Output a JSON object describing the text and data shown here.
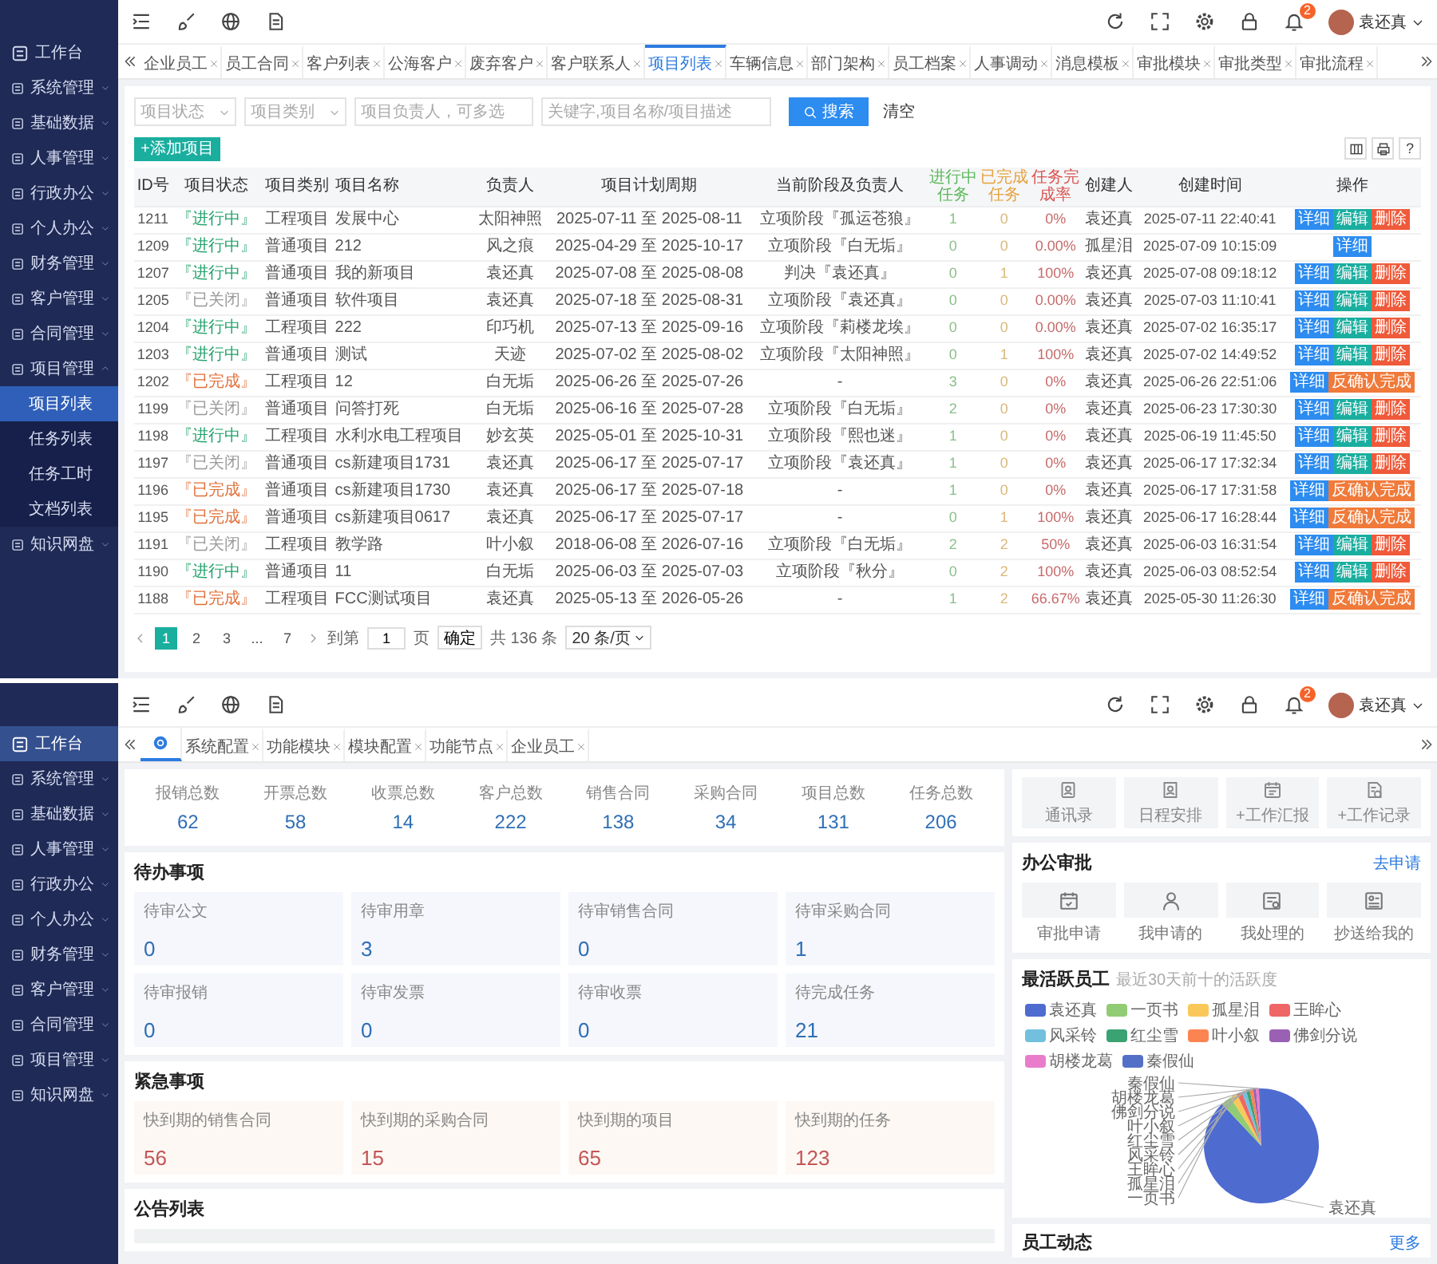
{
  "top_view": {
    "sidebar": [
      {
        "label": "工作台",
        "kind": "link",
        "selected": false
      },
      {
        "label": "系统管理",
        "kind": "group",
        "expanded": false,
        "selected": false
      },
      {
        "label": "基础数据",
        "kind": "group",
        "expanded": false,
        "selected": false
      },
      {
        "label": "人事管理",
        "kind": "group",
        "expanded": false,
        "selected": false
      },
      {
        "label": "行政办公",
        "kind": "group",
        "expanded": false,
        "selected": false
      },
      {
        "label": "个人办公",
        "kind": "group",
        "expanded": false,
        "selected": false
      },
      {
        "label": "财务管理",
        "kind": "group",
        "expanded": false,
        "selected": false
      },
      {
        "label": "客户管理",
        "kind": "group",
        "expanded": false,
        "selected": false
      },
      {
        "label": "合同管理",
        "kind": "group",
        "expanded": false,
        "selected": false
      },
      {
        "label": "项目管理",
        "kind": "group",
        "expanded": true,
        "selected": false,
        "children": [
          {
            "label": "项目列表",
            "selected": true
          },
          {
            "label": "任务列表",
            "selected": false
          },
          {
            "label": "任务工时",
            "selected": false
          },
          {
            "label": "文档列表",
            "selected": false
          }
        ]
      },
      {
        "label": "知识网盘",
        "kind": "group",
        "expanded": false,
        "selected": false
      }
    ],
    "header": {
      "notification_count": "2",
      "user_name": "袁还真"
    },
    "tabs": [
      {
        "label": "企业员工",
        "selected": false
      },
      {
        "label": "员工合同",
        "selected": false
      },
      {
        "label": "客户列表",
        "selected": false
      },
      {
        "label": "公海客户",
        "selected": false
      },
      {
        "label": "废弃客户",
        "selected": false
      },
      {
        "label": "客户联系人",
        "selected": false
      },
      {
        "label": "项目列表",
        "selected": true
      },
      {
        "label": "车辆信息",
        "selected": false
      },
      {
        "label": "部门架构",
        "selected": false
      },
      {
        "label": "员工档案",
        "selected": false
      },
      {
        "label": "人事调动",
        "selected": false
      },
      {
        "label": "消息模板",
        "selected": false
      },
      {
        "label": "审批模块",
        "selected": false
      },
      {
        "label": "审批类型",
        "selected": false
      },
      {
        "label": "审批流程",
        "selected": false
      }
    ],
    "filters": {
      "status_select": {
        "placeholder": "项目状态"
      },
      "category_select": {
        "placeholder": "项目类别"
      },
      "owner_field": {
        "placeholder": "项目负责人，可多选"
      },
      "keyword_field": {
        "placeholder": "关键字,项目名称/项目描述"
      },
      "search_button": "搜索",
      "clear_link": "清空"
    },
    "add_button": "+添加项目",
    "help_button": "?",
    "table": {
      "columns": [
        {
          "label": "ID号",
          "kind": "id"
        },
        {
          "label": "项目状态",
          "kind": "status"
        },
        {
          "label": "项目类别",
          "kind": "text"
        },
        {
          "label": "项目名称",
          "kind": "name"
        },
        {
          "label": "负责人",
          "kind": "text"
        },
        {
          "label": "项目计划周期",
          "kind": "text"
        },
        {
          "label": "当前阶段及负责人",
          "kind": "text"
        },
        {
          "label": "进行中任务",
          "kind": "green"
        },
        {
          "label": "已完成任务",
          "kind": "amber"
        },
        {
          "label": "任务完成率",
          "kind": "red"
        },
        {
          "label": "创建人",
          "kind": "text"
        },
        {
          "label": "创建时间",
          "kind": "datetime"
        },
        {
          "label": "操作",
          "kind": "actions"
        }
      ],
      "rows": [
        {
          "cells": [
            "1211",
            {
              "text": "『进行中』",
              "color": "#23a26c"
            },
            "工程项目",
            "发展中心",
            "太阳神照",
            "2025-07-11 至 2025-08-11",
            "立项阶段『孤运苍狼』",
            "1",
            "0",
            "0%",
            "袁还真",
            "2025-07-11 22:40:41"
          ],
          "actions": [
            {
              "label": "详细",
              "kind": "detail"
            },
            {
              "label": "编辑",
              "kind": "edit"
            },
            {
              "label": "删除",
              "kind": "delete"
            }
          ]
        },
        {
          "cells": [
            "1209",
            {
              "text": "『进行中』",
              "color": "#23a26c"
            },
            "普通项目",
            "212",
            "风之痕",
            "2025-04-29 至 2025-10-17",
            "立项阶段『白无垢』",
            "0",
            "0",
            "0.00%",
            "孤星泪",
            "2025-07-09 10:15:09"
          ],
          "actions": [
            {
              "label": "详细",
              "kind": "detail"
            }
          ]
        },
        {
          "cells": [
            "1207",
            {
              "text": "『进行中』",
              "color": "#23a26c"
            },
            "普通项目",
            "我的新项目",
            "袁还真",
            "2025-07-08 至 2025-08-08",
            "判决『袁还真』",
            "0",
            "1",
            "100%",
            "袁还真",
            "2025-07-08 09:18:12"
          ],
          "actions": [
            {
              "label": "详细",
              "kind": "detail"
            },
            {
              "label": "编辑",
              "kind": "edit"
            },
            {
              "label": "删除",
              "kind": "delete"
            }
          ]
        },
        {
          "cells": [
            "1205",
            {
              "text": "『已关闭』",
              "color": "#999999"
            },
            "普通项目",
            "软件项目",
            "袁还真",
            "2025-07-18 至 2025-08-31",
            "立项阶段『袁还真』",
            "0",
            "0",
            "0.00%",
            "袁还真",
            "2025-07-03 11:10:41"
          ],
          "actions": [
            {
              "label": "详细",
              "kind": "detail"
            },
            {
              "label": "编辑",
              "kind": "edit"
            },
            {
              "label": "删除",
              "kind": "delete"
            }
          ]
        },
        {
          "cells": [
            "1204",
            {
              "text": "『进行中』",
              "color": "#23a26c"
            },
            "工程项目",
            "222",
            "印巧机",
            "2025-07-13 至 2025-09-16",
            "立项阶段『莉楼龙埃』",
            "0",
            "0",
            "0.00%",
            "袁还真",
            "2025-07-02 16:35:17"
          ],
          "actions": [
            {
              "label": "详细",
              "kind": "detail"
            },
            {
              "label": "编辑",
              "kind": "edit"
            },
            {
              "label": "删除",
              "kind": "delete"
            }
          ]
        },
        {
          "cells": [
            "1203",
            {
              "text": "『进行中』",
              "color": "#23a26c"
            },
            "普通项目",
            "测试",
            "天迹",
            "2025-07-02 至 2025-08-02",
            "立项阶段『太阳神照』",
            "0",
            "1",
            "100%",
            "袁还真",
            "2025-07-02 14:49:52"
          ],
          "actions": [
            {
              "label": "详细",
              "kind": "detail"
            },
            {
              "label": "编辑",
              "kind": "edit"
            },
            {
              "label": "删除",
              "kind": "delete"
            }
          ]
        },
        {
          "cells": [
            "1202",
            {
              "text": "『已完成』",
              "color": "#e0703a"
            },
            "工程项目",
            "12",
            "白无垢",
            "2025-06-26 至 2025-07-26",
            "-",
            "3",
            "0",
            "0%",
            "袁还真",
            "2025-06-26 22:51:06"
          ],
          "actions": [
            {
              "label": "详细",
              "kind": "detail"
            },
            {
              "label": "反确认完成",
              "kind": "reconfirm"
            }
          ]
        },
        {
          "cells": [
            "1199",
            {
              "text": "『已关闭』",
              "color": "#999999"
            },
            "普通项目",
            "问答打死",
            "白无垢",
            "2025-06-16 至 2025-07-28",
            "立项阶段『白无垢』",
            "2",
            "0",
            "0%",
            "袁还真",
            "2025-06-23 17:30:30"
          ],
          "actions": [
            {
              "label": "详细",
              "kind": "detail"
            },
            {
              "label": "编辑",
              "kind": "edit"
            },
            {
              "label": "删除",
              "kind": "delete"
            }
          ]
        },
        {
          "cells": [
            "1198",
            {
              "text": "『进行中』",
              "color": "#23a26c"
            },
            "工程项目",
            "水利水电工程项目",
            "妙玄英",
            "2025-05-01 至 2025-10-31",
            "立项阶段『熙也迷』",
            "1",
            "0",
            "0%",
            "袁还真",
            "2025-06-19 11:45:50"
          ],
          "actions": [
            {
              "label": "详细",
              "kind": "detail"
            },
            {
              "label": "编辑",
              "kind": "edit"
            },
            {
              "label": "删除",
              "kind": "delete"
            }
          ]
        },
        {
          "cells": [
            "1197",
            {
              "text": "『已关闭』",
              "color": "#999999"
            },
            "普通项目",
            "cs新建项目1731",
            "袁还真",
            "2025-06-17 至 2025-07-17",
            "立项阶段『袁还真』",
            "1",
            "0",
            "0%",
            "袁还真",
            "2025-06-17 17:32:34"
          ],
          "actions": [
            {
              "label": "详细",
              "kind": "detail"
            },
            {
              "label": "编辑",
              "kind": "edit"
            },
            {
              "label": "删除",
              "kind": "delete"
            }
          ]
        },
        {
          "cells": [
            "1196",
            {
              "text": "『已完成』",
              "color": "#e0703a"
            },
            "普通项目",
            "cs新建项目1730",
            "袁还真",
            "2025-06-17 至 2025-07-18",
            "-",
            "1",
            "0",
            "0%",
            "袁还真",
            "2025-06-17 17:31:58"
          ],
          "actions": [
            {
              "label": "详细",
              "kind": "detail"
            },
            {
              "label": "反确认完成",
              "kind": "reconfirm"
            }
          ]
        },
        {
          "cells": [
            "1195",
            {
              "text": "『已完成』",
              "color": "#e0703a"
            },
            "普通项目",
            "cs新建项目0617",
            "袁还真",
            "2025-06-17 至 2025-07-17",
            "-",
            "0",
            "1",
            "100%",
            "袁还真",
            "2025-06-17 16:28:44"
          ],
          "actions": [
            {
              "label": "详细",
              "kind": "detail"
            },
            {
              "label": "反确认完成",
              "kind": "reconfirm"
            }
          ]
        },
        {
          "cells": [
            "1191",
            {
              "text": "『已关闭』",
              "color": "#999999"
            },
            "工程项目",
            "教学路",
            "叶小叙",
            "2018-06-08 至 2026-07-16",
            "立项阶段『白无垢』",
            "2",
            "2",
            "50%",
            "袁还真",
            "2025-06-03 16:31:54"
          ],
          "actions": [
            {
              "label": "详细",
              "kind": "detail"
            },
            {
              "label": "编辑",
              "kind": "edit"
            },
            {
              "label": "删除",
              "kind": "delete"
            }
          ]
        },
        {
          "cells": [
            "1190",
            {
              "text": "『进行中』",
              "color": "#23a26c"
            },
            "普通项目",
            "11",
            "白无垢",
            "2025-06-03 至 2025-07-03",
            "立项阶段『秋分』",
            "0",
            "2",
            "100%",
            "袁还真",
            "2025-06-03 08:52:54"
          ],
          "actions": [
            {
              "label": "详细",
              "kind": "detail"
            },
            {
              "label": "编辑",
              "kind": "edit"
            },
            {
              "label": "删除",
              "kind": "delete"
            }
          ]
        },
        {
          "cells": [
            "1188",
            {
              "text": "『已完成』",
              "color": "#e0703a"
            },
            "工程项目",
            "FCC测试项目",
            "袁还真",
            "2025-05-13 至 2026-05-26",
            "-",
            "1",
            "2",
            "66.67%",
            "袁还真",
            "2025-05-30 11:26:30"
          ],
          "actions": [
            {
              "label": "详细",
              "kind": "detail"
            },
            {
              "label": "反确认完成",
              "kind": "reconfirm"
            }
          ]
        }
      ]
    },
    "pagination": {
      "pages": [
        {
          "label": "1",
          "selected": true
        },
        {
          "label": "2",
          "selected": false
        },
        {
          "label": "3",
          "selected": false
        },
        {
          "label": "...",
          "selected": false
        },
        {
          "label": "7",
          "selected": false
        }
      ],
      "goto_label": "到第",
      "goto_value": "1",
      "page_unit": "页",
      "confirm": "确定",
      "total": "共 136 条",
      "page_size": "20 条/页"
    }
  },
  "bottom_view": {
    "sidebar": [
      {
        "label": "工作台",
        "kind": "link",
        "selected": true
      },
      {
        "label": "系统管理",
        "kind": "group",
        "expanded": false,
        "selected": false
      },
      {
        "label": "基础数据",
        "kind": "group",
        "expanded": false,
        "selected": false
      },
      {
        "label": "人事管理",
        "kind": "group",
        "expanded": false,
        "selected": false
      },
      {
        "label": "行政办公",
        "kind": "group",
        "expanded": false,
        "selected": false
      },
      {
        "label": "个人办公",
        "kind": "group",
        "expanded": false,
        "selected": false
      },
      {
        "label": "财务管理",
        "kind": "group",
        "expanded": false,
        "selected": false
      },
      {
        "label": "客户管理",
        "kind": "group",
        "expanded": false,
        "selected": false
      },
      {
        "label": "合同管理",
        "kind": "group",
        "expanded": false,
        "selected": false
      },
      {
        "label": "项目管理",
        "kind": "group",
        "expanded": false,
        "selected": false
      },
      {
        "label": "知识网盘",
        "kind": "group",
        "expanded": false,
        "selected": false
      }
    ],
    "header": {
      "notification_count": "2",
      "user_name": "袁还真"
    },
    "tabs": [
      {
        "kind": "home",
        "selected": true
      },
      {
        "kind": "page",
        "label": "系统配置",
        "selected": false
      },
      {
        "kind": "page",
        "label": "功能模块",
        "selected": false
      },
      {
        "kind": "page",
        "label": "模块配置",
        "selected": false
      },
      {
        "kind": "page",
        "label": "功能节点",
        "selected": false
      },
      {
        "kind": "page",
        "label": "企业员工",
        "selected": false
      }
    ],
    "stats": [
      {
        "label": "报销总数",
        "value": "62"
      },
      {
        "label": "开票总数",
        "value": "58"
      },
      {
        "label": "收票总数",
        "value": "14"
      },
      {
        "label": "客户总数",
        "value": "222"
      },
      {
        "label": "销售合同",
        "value": "138"
      },
      {
        "label": "采购合同",
        "value": "34"
      },
      {
        "label": "项目总数",
        "value": "131"
      },
      {
        "label": "任务总数",
        "value": "206"
      }
    ],
    "quick_links": [
      {
        "label": "通讯录",
        "kind": "contacts"
      },
      {
        "label": "日程安排",
        "kind": "schedule"
      },
      {
        "label": "+工作汇报",
        "kind": "report"
      },
      {
        "label": "+工作记录",
        "kind": "record"
      }
    ],
    "todo": {
      "title": "待办事项",
      "items": [
        {
          "label": "待审公文",
          "value": "0"
        },
        {
          "label": "待审用章",
          "value": "3"
        },
        {
          "label": "待审销售合同",
          "value": "0"
        },
        {
          "label": "待审采购合同",
          "value": "1"
        },
        {
          "label": "待审报销",
          "value": "0"
        },
        {
          "label": "待审发票",
          "value": "0"
        },
        {
          "label": "待审收票",
          "value": "0"
        },
        {
          "label": "待完成任务",
          "value": "21"
        }
      ]
    },
    "urgent": {
      "title": "紧急事项",
      "items": [
        {
          "label": "快到期的销售合同",
          "value": "56"
        },
        {
          "label": "快到期的采购合同",
          "value": "15"
        },
        {
          "label": "快到期的项目",
          "value": "65"
        },
        {
          "label": "快到期的任务",
          "value": "123"
        }
      ]
    },
    "notices": {
      "title": "公告列表"
    },
    "approval": {
      "title": "办公审批",
      "link": "去申请",
      "items": [
        {
          "label": "审批申请",
          "kind": "calendar"
        },
        {
          "label": "我申请的",
          "kind": "person"
        },
        {
          "label": "我处理的",
          "kind": "form"
        },
        {
          "label": "抄送给我的",
          "kind": "card"
        }
      ]
    },
    "active_staff": {
      "title": "最活跃员工",
      "subtitle": "最近30天前十的活跃度",
      "legend": [
        {
          "name": "袁还真",
          "color": "#4e6bd0"
        },
        {
          "name": "一页书",
          "color": "#91cc75"
        },
        {
          "name": "孤星泪",
          "color": "#fac858"
        },
        {
          "name": "王眸心",
          "color": "#ee6666"
        },
        {
          "name": "风采铃",
          "color": "#73c0de"
        },
        {
          "name": "红尘雪",
          "color": "#3ba272"
        },
        {
          "name": "叶小叙",
          "color": "#fc8452"
        },
        {
          "name": "佛剑分说",
          "color": "#9a60b4"
        },
        {
          "name": "胡楼龙葛",
          "color": "#ea7ccc"
        },
        {
          "name": "秦假仙",
          "color": "#5470c6"
        }
      ],
      "slice_labels": [
        "秦假仙",
        "胡楼龙葛",
        "佛剑分说",
        "叶小叙",
        "红尘雪",
        "风采铃",
        "王眸心",
        "孤星泪",
        "一页书",
        "袁还真"
      ]
    },
    "staff_feed": {
      "title": "员工动态",
      "link": "更多"
    }
  }
}
